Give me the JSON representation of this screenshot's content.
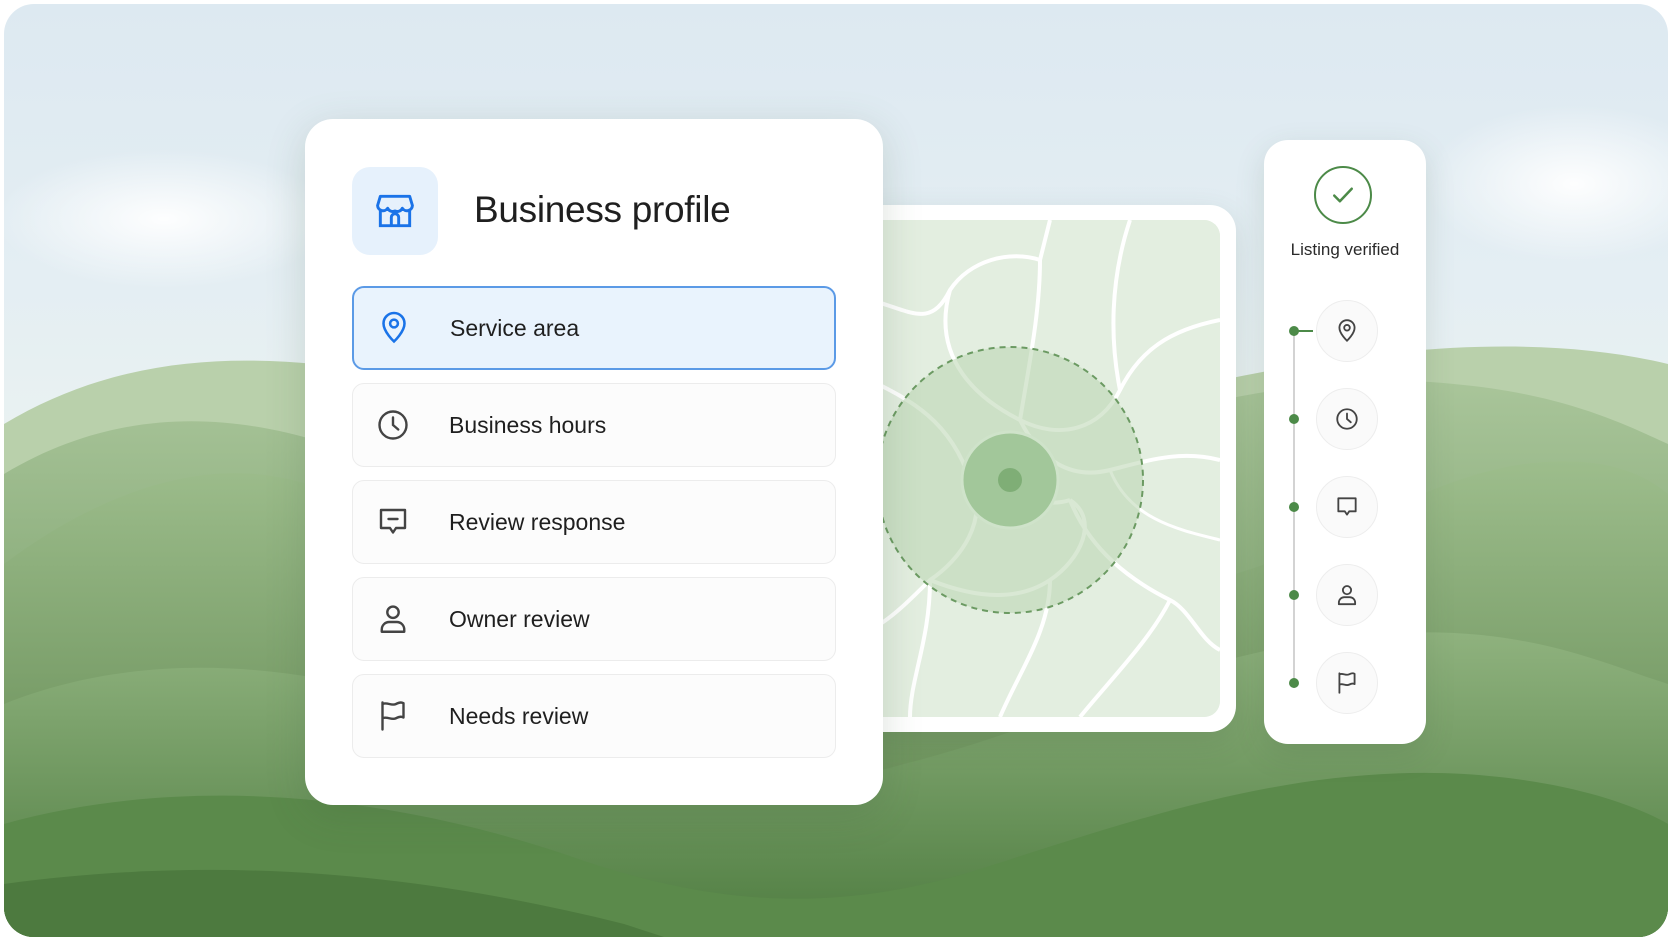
{
  "profile": {
    "title": "Business profile",
    "icon": "storefront-icon",
    "items": [
      {
        "label": "Service area",
        "icon": "location-pin-icon",
        "active": true
      },
      {
        "label": "Business hours",
        "icon": "clock-icon",
        "active": false
      },
      {
        "label": "Review response",
        "icon": "message-icon",
        "active": false
      },
      {
        "label": "Owner review",
        "icon": "person-icon",
        "active": false
      },
      {
        "label": "Needs review",
        "icon": "flag-icon",
        "active": false
      }
    ]
  },
  "status": {
    "label": "Listing verified",
    "icon": "check-circle-icon",
    "steps": [
      "location-pin-icon",
      "clock-icon",
      "message-icon",
      "person-icon",
      "flag-icon"
    ]
  },
  "colors": {
    "accent_blue": "#1a73e8",
    "active_bg": "#e9f3fd",
    "verified_green": "#4c8a48",
    "hill_green": "#6f9a5e"
  }
}
